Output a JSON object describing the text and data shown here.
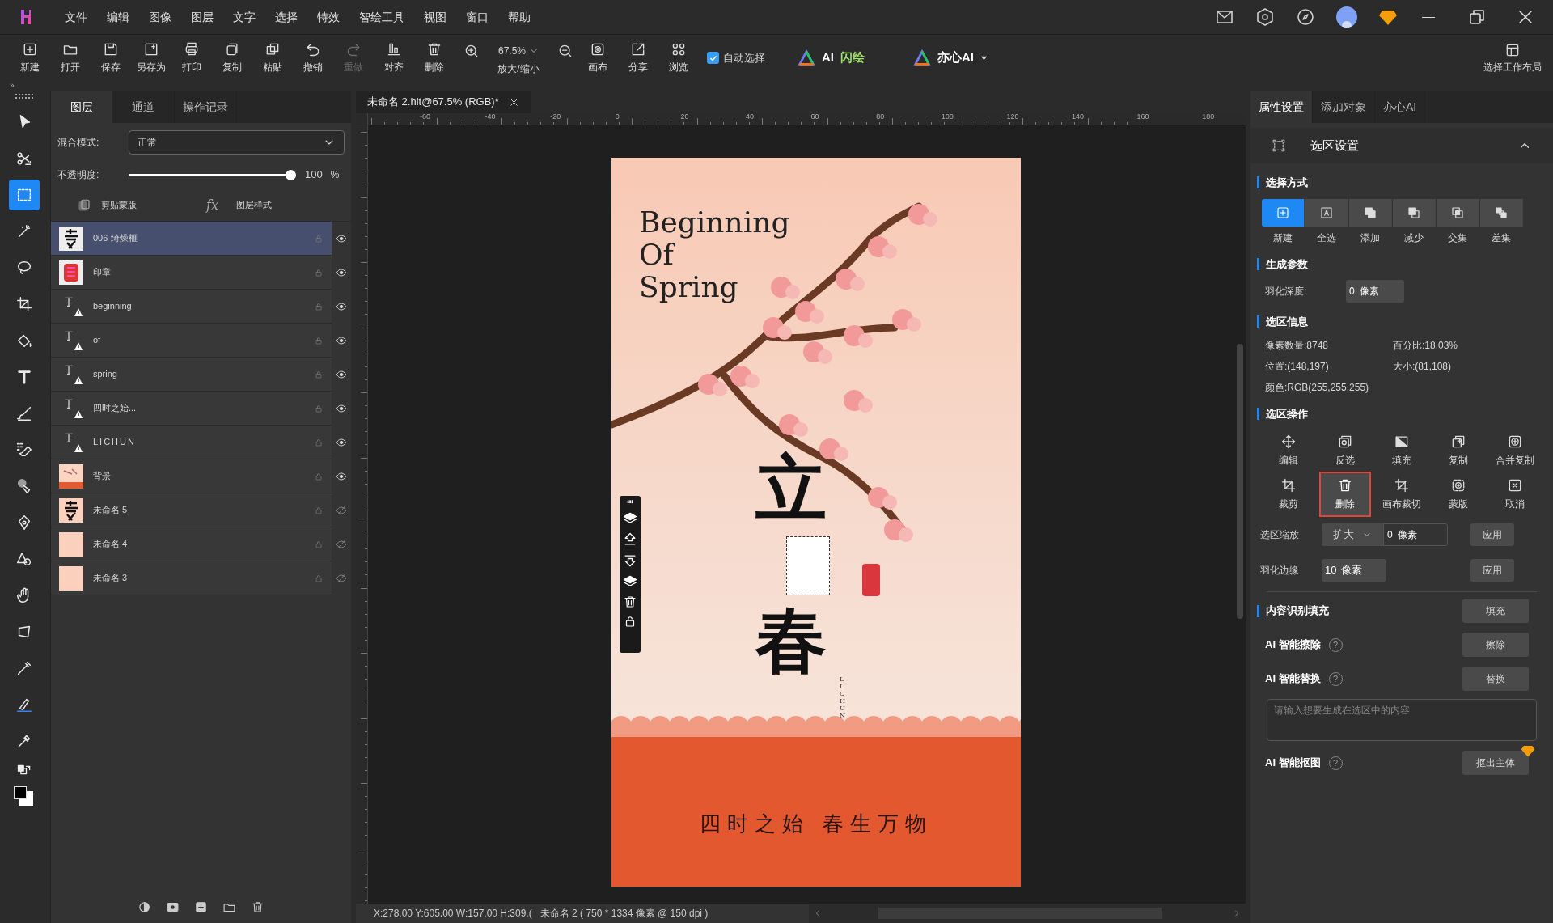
{
  "menu": [
    "文件",
    "编辑",
    "图像",
    "图层",
    "文字",
    "选择",
    "特效",
    "智绘工具",
    "视图",
    "窗口",
    "帮助"
  ],
  "toolbar": {
    "buttons": [
      {
        "label": "新建",
        "disabled": false
      },
      {
        "label": "打开",
        "disabled": false
      },
      {
        "label": "保存",
        "disabled": false
      },
      {
        "label": "另存为",
        "disabled": false
      },
      {
        "label": "打印",
        "disabled": false
      },
      {
        "label": "复制",
        "disabled": false
      },
      {
        "label": "粘贴",
        "disabled": false
      },
      {
        "label": "撤销",
        "disabled": false
      },
      {
        "label": "重做",
        "disabled": true
      },
      {
        "label": "对齐",
        "disabled": false
      },
      {
        "label": "删除",
        "disabled": false
      }
    ],
    "zoom": {
      "value": "67.5%",
      "label": "放大/缩小"
    },
    "after_zoom": [
      {
        "label": "画布"
      },
      {
        "label": "分享"
      },
      {
        "label": "浏览"
      }
    ],
    "auto_select": {
      "label": "自动选择",
      "checked": true
    },
    "ai_buttons": [
      {
        "label": "AI",
        "accent": "闪绘",
        "dropdown": false
      },
      {
        "label": "亦心AI",
        "dropdown": true
      }
    ],
    "layout_button": "选择工作布局"
  },
  "panel_toggle": "»",
  "tools": [
    {
      "kind": "pointer",
      "selected": false
    },
    {
      "kind": "scissors",
      "selected": false
    },
    {
      "kind": "marquee",
      "selected": true
    },
    {
      "kind": "wand",
      "selected": false
    },
    {
      "kind": "lasso",
      "selected": false
    },
    {
      "kind": "crop",
      "selected": false
    },
    {
      "kind": "bucket",
      "selected": false
    },
    {
      "kind": "text",
      "selected": false
    },
    {
      "kind": "brush",
      "selected": false
    },
    {
      "kind": "eraser",
      "selected": false
    },
    {
      "kind": "stamp",
      "selected": false
    },
    {
      "kind": "pen",
      "selected": false
    },
    {
      "kind": "shapes",
      "selected": false
    },
    {
      "kind": "hand",
      "selected": false
    },
    {
      "kind": "transform",
      "selected": false
    },
    {
      "kind": "heal",
      "selected": false
    },
    {
      "kind": "marker",
      "selected": false
    },
    {
      "kind": "dropper",
      "selected": false
    }
  ],
  "layers_panel": {
    "tabs": [
      {
        "label": "图层",
        "selected": true
      },
      {
        "label": "通道",
        "selected": false
      },
      {
        "label": "操作记录",
        "selected": false
      }
    ],
    "blend_mode": {
      "label": "混合模式:",
      "value": "正常"
    },
    "opacity": {
      "label": "不透明度:",
      "level": 1.0,
      "reading": "100",
      "unit": "%"
    },
    "clip_mask": "剪贴蒙版",
    "fx_icon": "fx",
    "layer_style": "图层样式",
    "layers": [
      {
        "name": "006-绮燥榧",
        "kind": "calligraphy",
        "selected": true,
        "visible": true
      },
      {
        "name": "印章",
        "kind": "seal",
        "selected": false,
        "visible": true
      },
      {
        "name": "beginning",
        "kind": "text",
        "selected": false,
        "visible": true
      },
      {
        "name": "of",
        "kind": "text",
        "selected": false,
        "visible": true
      },
      {
        "name": "spring",
        "kind": "text",
        "selected": false,
        "visible": true
      },
      {
        "name": "四时之始...",
        "kind": "text",
        "selected": false,
        "visible": true
      },
      {
        "name": "LICHUN",
        "kind": "text",
        "selected": false,
        "visible": true
      },
      {
        "name": "背景",
        "kind": "background",
        "selected": false,
        "visible": true
      },
      {
        "name": "未命名 5",
        "kind": "calligraphy",
        "selected": false,
        "visible": false
      },
      {
        "name": "未命名 4",
        "kind": "fill",
        "selected": false,
        "visible": false
      },
      {
        "name": "未命名 3",
        "kind": "fill",
        "selected": false,
        "visible": false
      }
    ]
  },
  "document": {
    "tab": "未命名 2.hit@67.5% (RGB)*",
    "ruler_labels": [
      "-60",
      "-40",
      "-20",
      "0",
      "20",
      "40",
      "60",
      "80",
      "100",
      "120",
      "140",
      "160",
      "180"
    ],
    "poster": {
      "title_lines": [
        "Beginning",
        "Of",
        "Spring"
      ],
      "calligraphy": [
        "立",
        "春"
      ],
      "vertical_text": "LICHUN",
      "subtitle": "四时之始 春生万物"
    },
    "status": {
      "coords": "X:278.00 Y:605.00 W:157.00 H:309.(",
      "doc_info": "未命名 2 ( 750 * 1334 像素 @ 150 dpi )"
    }
  },
  "properties_panel": {
    "tabs": [
      {
        "label": "属性设置",
        "selected": true
      },
      {
        "label": "添加对象",
        "selected": false
      },
      {
        "label": "亦心AI",
        "selected": false
      }
    ],
    "section_title": "选区设置",
    "expanded": true,
    "select_mode": {
      "heading": "选择方式",
      "modes": [
        {
          "label": "新建",
          "selected": true
        },
        {
          "label": "全选",
          "selected": false
        },
        {
          "label": "添加",
          "selected": false
        },
        {
          "label": "减少",
          "selected": false
        },
        {
          "label": "交集",
          "selected": false
        },
        {
          "label": "差集",
          "selected": false
        }
      ]
    },
    "params": {
      "heading": "生成参数",
      "feather_label": "羽化深度:",
      "feather_value": "0",
      "unit": "像素"
    },
    "info": {
      "heading": "选区信息",
      "items": [
        "像素数量:8748",
        "百分比:18.03%",
        "位置:(148,197)",
        "大小:(81,108)",
        "颜色:RGB(255,255,255)"
      ]
    },
    "operations": {
      "heading": "选区操作",
      "items": [
        {
          "label": "编辑",
          "selected": false
        },
        {
          "label": "反选",
          "selected": false
        },
        {
          "label": "填充",
          "selected": false
        },
        {
          "label": "复制",
          "selected": false
        },
        {
          "label": "合并复制",
          "selected": false
        },
        {
          "label": "裁剪",
          "selected": false
        },
        {
          "label": "删除",
          "selected": true
        },
        {
          "label": "画布裁切",
          "selected": false
        },
        {
          "label": "蒙版",
          "selected": false
        },
        {
          "label": "取消",
          "selected": false
        }
      ]
    },
    "scale": {
      "label": "选区缩放",
      "mode": "扩大",
      "value": "0",
      "unit": "像素",
      "apply": "应用"
    },
    "feather_edge": {
      "label": "羽化边缘",
      "value": "10",
      "unit": "像素",
      "apply": "应用"
    },
    "content_fill": {
      "heading": "内容识别填充",
      "button": "填充"
    },
    "ai_tools": [
      {
        "label": "AI 智能擦除",
        "help": "?",
        "button": "擦除",
        "badge": false
      },
      {
        "label": "AI 智能替换",
        "help": "?",
        "button": "替换",
        "badge": false
      }
    ],
    "prompt_placeholder": "请输入想要生成在选区中的内容",
    "cutout": {
      "label": "AI 智能抠图",
      "help": "?",
      "button": "抠出主体",
      "badge": true
    }
  }
}
